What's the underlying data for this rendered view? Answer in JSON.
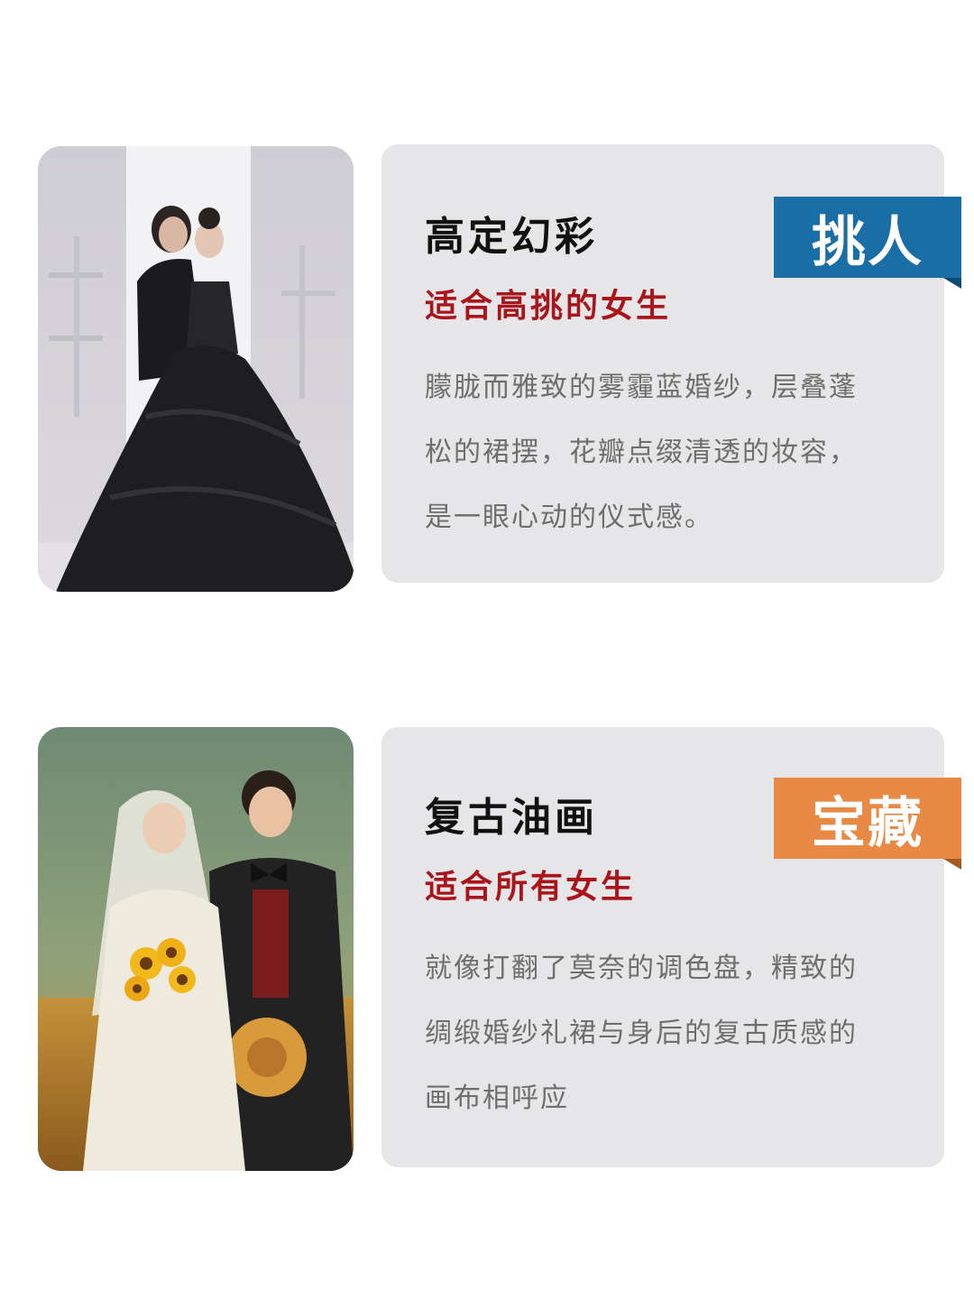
{
  "sections": [
    {
      "title": "高定幻彩",
      "subtitle": "适合高挑的女生",
      "desc_lines": [
        "朦胧而雅致的雾霾蓝婚纱，层叠蓬",
        "松的裙摆，花瓣点缀清透的妆容，",
        "是一眼心动的仪式感。"
      ],
      "badge": "挑人",
      "badge_color": "#1a6ea6",
      "badge_fold_color": "#0e4a75"
    },
    {
      "title": "复古油画",
      "subtitle": "适合所有女生",
      "desc_lines": [
        "就像打翻了莫奈的调色盘，精致的",
        "绸缎婚纱礼裙与身后的复古质感的",
        "画布相呼应"
      ],
      "badge": "宝藏",
      "badge_color": "#e88a45",
      "badge_fold_color": "#a35a22"
    }
  ]
}
